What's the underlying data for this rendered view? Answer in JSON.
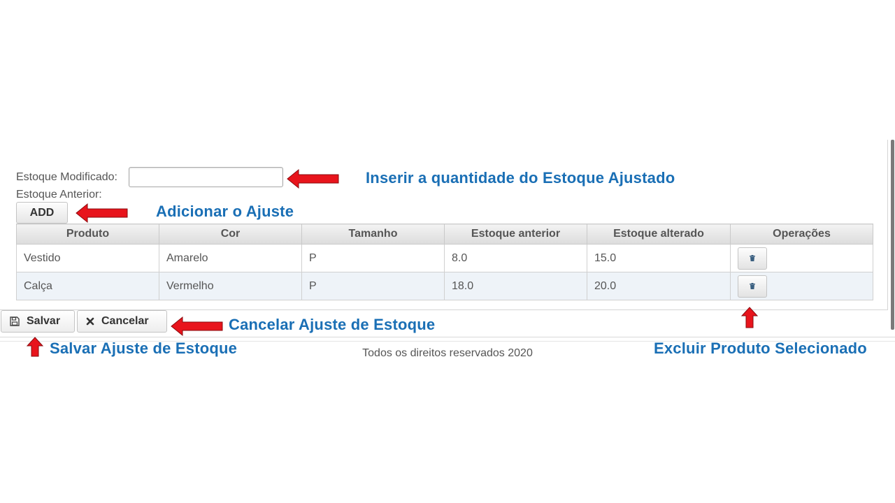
{
  "form": {
    "estoque_modificado_label": "Estoque Modificado:",
    "estoque_modificado_value": "",
    "estoque_anterior_label": "Estoque Anterior:",
    "add_label": "ADD"
  },
  "table": {
    "columns": [
      "Produto",
      "Cor",
      "Tamanho",
      "Estoque anterior",
      "Estoque alterado",
      "Operações"
    ],
    "rows": [
      {
        "produto": "Vestido",
        "cor": "Amarelo",
        "tamanho": "P",
        "estoque_anterior": "8.0",
        "estoque_alterado": "15.0"
      },
      {
        "produto": "Calça",
        "cor": "Vermelho",
        "tamanho": "P",
        "estoque_anterior": "18.0",
        "estoque_alterado": "20.0"
      }
    ]
  },
  "actions": {
    "save_label": "Salvar",
    "cancel_label": "Cancelar"
  },
  "footer": {
    "text": "Todos os direitos reservados 2020"
  },
  "annotations": {
    "input_hint": "Inserir a quantidade do Estoque Ajustado",
    "add_hint": "Adicionar o Ajuste",
    "cancel_hint": "Cancelar Ajuste de Estoque",
    "save_hint": "Salvar Ajuste de Estoque",
    "delete_hint": "Excluir Produto Selecionado"
  },
  "icons": {
    "save": "floppy-disk-icon",
    "cancel": "close-icon",
    "delete": "trash-icon",
    "arrow": "red-arrow-icon"
  },
  "colors": {
    "annotation": "#1a6fb5",
    "arrow": "#e8141c",
    "row_alt": "#eef3f8"
  }
}
